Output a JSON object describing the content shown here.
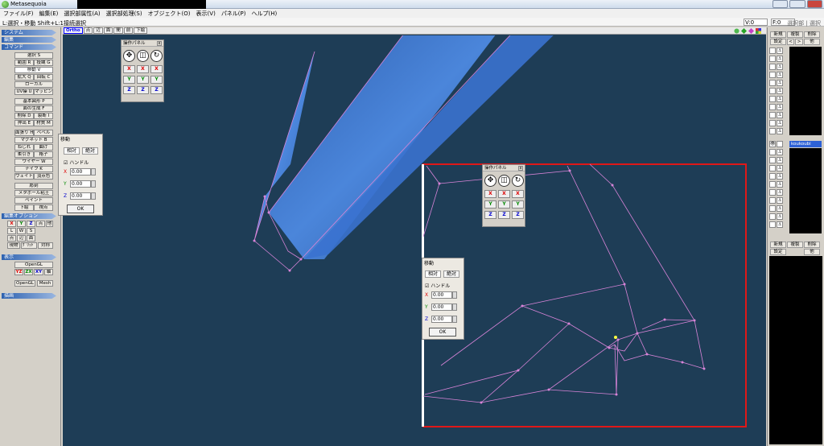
{
  "window": {
    "title": "Metasequoia"
  },
  "menu": [
    "ファイル(F)",
    "編集(E)",
    "選択部属性(A)",
    "選択部処理(S)",
    "オブジェクト(O)",
    "表示(V)",
    "パネル(P)",
    "ヘルプ(H)"
  ],
  "status": {
    "hint": "L:選択・移動  Shift+L:1接続選択",
    "v": "V:0",
    "f": "F:0",
    "clear": "選択部 | 選択"
  },
  "left": {
    "system": "システム",
    "edit": "編集",
    "command": "コマンド",
    "select": "選択 S",
    "range": "範囲 R",
    "lasso": "投縄 G",
    "move": "移動 V",
    "scale": "拡大 Q",
    "rotate": "回転 C",
    "local": "ローカル",
    "uv": "UV操 U",
    "mapping": "マッピング",
    "primitive": "基本図形 P",
    "face_gen": "面の生成 F",
    "delete": "削除 D",
    "knife": "裂断 I",
    "extrude": "押出 E",
    "material": "材質 M",
    "bevel": "面張り H",
    "bevel2": "ベベル",
    "magnet": "マグネット B",
    "twist": "ねじれ",
    "bend": "曲げ",
    "soft": "柔引き",
    "lattice": "格子",
    "wire": "ワイヤー W",
    "knife2": "ナイフ K",
    "weight": "ウェイト",
    "vcolor": "頂点色",
    "sculpt": "彫刻",
    "meta": "メタボール粘土",
    "paint": "ペイント",
    "draw": "下絵",
    "viewpt": "視点",
    "edit_option": "編集オプション",
    "opt_x": "X",
    "opt_y": "Y",
    "opt_z": "Z",
    "opt_snap": "点",
    "opt_other": "他",
    "opt_l": "L",
    "opt_w": "W",
    "opt_s": "S",
    "pt": "点",
    "edge": "辺",
    "face": "面",
    "through": "現物",
    "grid": "ｸﾞﾘｯﾄﾞ",
    "sym": "対称",
    "display": "表示",
    "opengl": "OpenGL",
    "yz": "YZ",
    "zx": "ZX",
    "xy": "XY",
    "axis": "軸",
    "opengl2": "OpenGL",
    "mesh": "Mesh",
    "drawing": "描画"
  },
  "viewport": {
    "tabs": [
      "Ortho",
      "点",
      "辺",
      "面",
      "間",
      "前",
      "下絵"
    ]
  },
  "op_panel_1": {
    "title": "操作パネル",
    "close": "x",
    "x": "X",
    "y": "Y",
    "z": "Z"
  },
  "op_panel_2": {
    "title": "操作パネル",
    "close": "x",
    "x": "X",
    "y": "Y",
    "z": "Z"
  },
  "move_1": {
    "title": "移動",
    "tab_rel": "相対",
    "tab_abs": "絶対",
    "handle": "ハンドル",
    "x": "X",
    "y": "Y",
    "z": "Z",
    "vx": "0.00",
    "vy": "0.00",
    "vz": "0.00",
    "ok": "OK"
  },
  "move_2": {
    "title": "移動",
    "tab_rel": "相対",
    "tab_abs": "絶対",
    "handle": "ハンドル",
    "x": "X",
    "y": "Y",
    "z": "Z",
    "vx": "0.00",
    "vy": "0.00",
    "vz": "0.00",
    "ok": "OK"
  },
  "right": {
    "new": "新規",
    "dup": "複製",
    "del": "削除",
    "settings": "設定",
    "prev": "<",
    "next": ">",
    "other": "他",
    "object_name": "koukoubi",
    "new2": "新規",
    "dup2": "複製",
    "del2": "削除",
    "settings2": "設定",
    "other2": "他"
  },
  "colors": {
    "viewport_bg": "#1e3d56",
    "wire": "#d884d8",
    "selection_rect": "#e01818",
    "mesh_blue": "#3e7ad8"
  }
}
